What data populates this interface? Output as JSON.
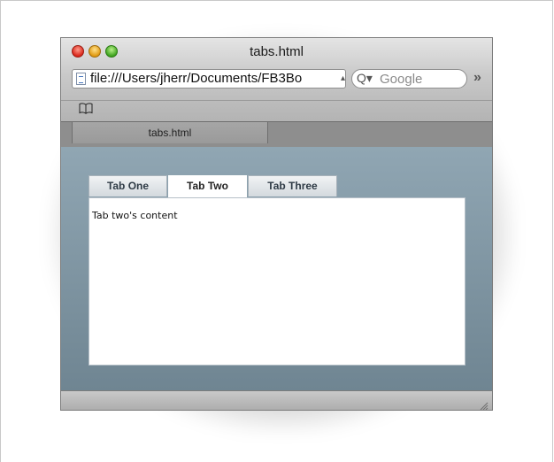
{
  "window": {
    "title": "tabs.html"
  },
  "toolbar": {
    "url_value": "file:///Users/jherr/Documents/FB3Bo",
    "search_placeholder": "Google",
    "search_icon_glyph": "Q▾",
    "overflow_glyph": "»"
  },
  "bookmarks": {
    "icon": "book-icon",
    "icon_glyph": "📖"
  },
  "browser_tabs": [
    {
      "label": "tabs.html",
      "active": true
    }
  ],
  "page": {
    "tabs": [
      {
        "label": "Tab One",
        "active": false
      },
      {
        "label": "Tab Two",
        "active": true
      },
      {
        "label": "Tab Three",
        "active": false
      }
    ],
    "panel_text": "Tab two's content"
  },
  "colors": {
    "content_gradient_top": "#90a6b3",
    "content_gradient_bottom": "#6f8592",
    "tab_text": "#2f3b46"
  }
}
